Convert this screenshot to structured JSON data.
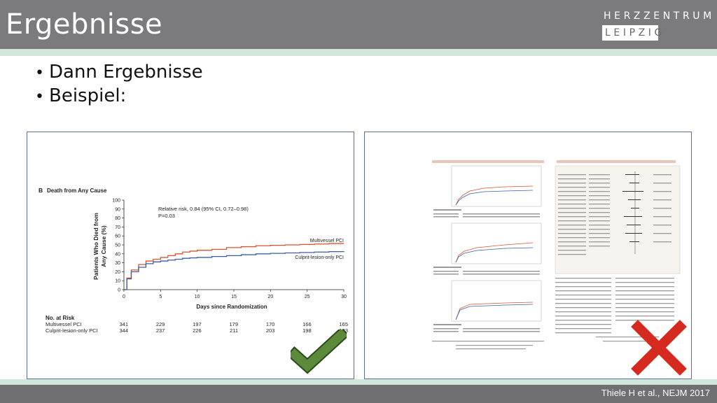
{
  "slide": {
    "title": "Ergebnisse",
    "logo": {
      "line1": "HERZZENTRUM",
      "line2": "LEIPZIG"
    },
    "bullets": [
      "Dann Ergebnisse",
      "Beispiel:"
    ],
    "citation": "Thiele H et al., NEJM 2017",
    "colors": {
      "header": "#7b7b7e",
      "stripe": "#d2e7dc",
      "check": "#5b8a3a",
      "cross": "#d42b1e"
    },
    "left_panel_mark": "check-icon",
    "right_panel_mark": "cross-icon"
  },
  "figure": {
    "panel_letter": "B",
    "panel_title": "Death from Any Cause",
    "ylabel_line1": "Patients Who Died from",
    "ylabel_line2": "Any Cause (%)",
    "xlabel": "Days since Randomization",
    "annotation_line1": "Relative risk, 0.84 (95% CI, 0.72–0.98)",
    "annotation_line2": "P=0.03",
    "series_label_1": "Multivessel PCI",
    "series_label_2": "Culprit-lesion-only PCI",
    "risk_title": "No. at Risk",
    "risk_rows": [
      {
        "label": "Multivessel PCI",
        "values": [
          "341",
          "229",
          "197",
          "179",
          "170",
          "166",
          "165"
        ]
      },
      {
        "label": "Culprit-lesion-only PCI",
        "values": [
          "344",
          "237",
          "226",
          "211",
          "203",
          "198",
          "193"
        ]
      }
    ]
  },
  "chart_data": {
    "type": "line",
    "xlabel": "Days since Randomization",
    "ylabel": "Patients Who Died from Any Cause (%)",
    "title": "Death from Any Cause",
    "xlim": [
      0,
      30
    ],
    "ylim": [
      0,
      100
    ],
    "xticks": [
      0,
      5,
      10,
      15,
      20,
      25,
      30
    ],
    "yticks": [
      0,
      10,
      20,
      30,
      40,
      50,
      60,
      70,
      80,
      90,
      100
    ],
    "series": [
      {
        "name": "Multivessel PCI",
        "color": "#d9542e",
        "x": [
          0,
          0.4,
          1,
          2,
          3,
          4,
          5,
          6,
          7,
          8,
          9,
          10,
          12,
          14,
          16,
          18,
          20,
          22,
          24,
          26,
          28,
          30
        ],
        "y": [
          0,
          13,
          22,
          28,
          32,
          34,
          36,
          38,
          40,
          42,
          43,
          44,
          45,
          47,
          48,
          49,
          49.5,
          50,
          50.5,
          51,
          51.5,
          51.5
        ]
      },
      {
        "name": "Culprit-lesion-only PCI",
        "color": "#3a5fa8",
        "x": [
          0,
          0.4,
          1,
          2,
          3,
          4,
          5,
          6,
          7,
          8,
          9,
          10,
          12,
          14,
          16,
          18,
          20,
          22,
          24,
          26,
          28,
          30
        ],
        "y": [
          0,
          12,
          20,
          25,
          29,
          31,
          32,
          33,
          34,
          35,
          35.5,
          36,
          37,
          38,
          39,
          40,
          40.5,
          41,
          41.5,
          42,
          42.5,
          43
        ]
      }
    ]
  }
}
